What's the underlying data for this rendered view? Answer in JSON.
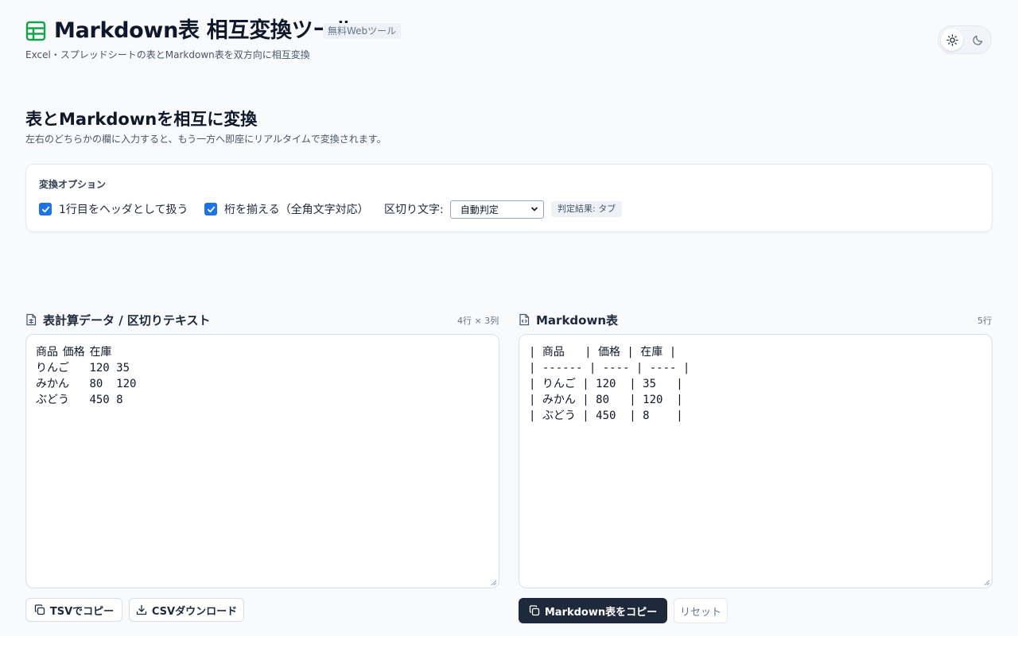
{
  "header": {
    "title": "Markdown表 相互変換ツール",
    "badge": "無料Webツール",
    "subtitle": "Excel・スプレッドシートの表とMarkdown表を双方向に相互変換",
    "logo_icon": "table-icon",
    "theme": {
      "light_icon": "sun-icon",
      "dark_icon": "moon-icon",
      "selected": "light"
    }
  },
  "intro": {
    "title": "表とMarkdownを相互に変換",
    "description": "左右のどちらかの欄に入力すると、もう一方へ即座にリアルタイムで変換されます。"
  },
  "options": {
    "heading": "変換オプション",
    "header_row_label": "1行目をヘッダとして扱う",
    "header_row_checked": true,
    "align_label": "桁を揃える（全角文字対応）",
    "align_checked": true,
    "delimiter_label": "区切り文字:",
    "delimiter_value": "自動判定",
    "detect_result": "判定結果: タブ"
  },
  "left_panel": {
    "title": "表計算データ / 区切りテキスト",
    "meta": "4行 × 3列",
    "content": "商品\t価格\t在庫\nりんご\t120\t35\nみかん\t80\t120\nぶどう\t450\t8",
    "buttons": {
      "copy_tsv": "TSVでコピー",
      "download_csv": "CSVダウンロード"
    }
  },
  "right_panel": {
    "title": "Markdown表",
    "meta": "5行",
    "content": "| 商品   | 価格 | 在庫 |\n| ------ | ---- | ---- |\n| りんご | 120  | 35   |\n| みかん | 80   | 120  |\n| ぶどう | 450  | 8    |",
    "buttons": {
      "copy_markdown": "Markdown表をコピー",
      "reset": "リセット"
    }
  },
  "colors": {
    "accent": "#1d72e8",
    "primary_button": "#1e293b",
    "logo": "#16a34a",
    "background": "#f8fafc"
  }
}
